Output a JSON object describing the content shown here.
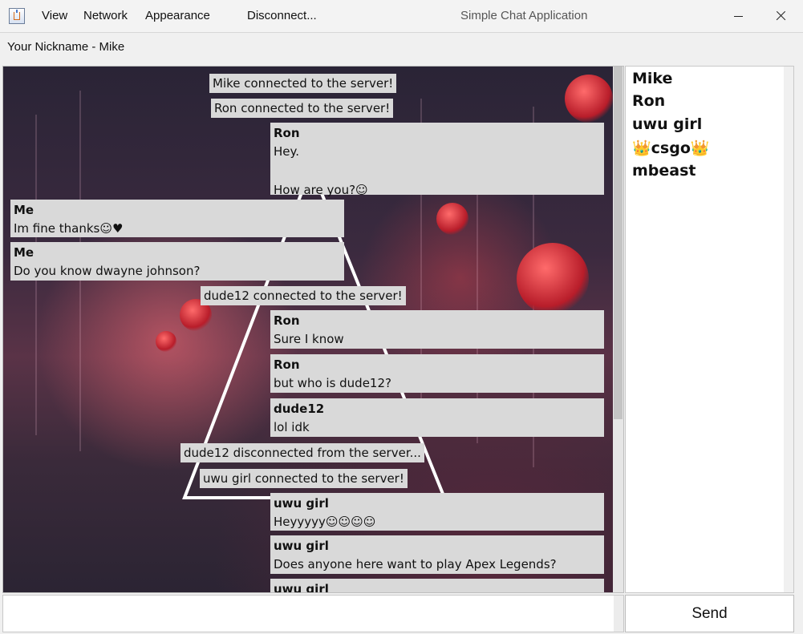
{
  "window": {
    "title": "Simple Chat Application",
    "minimize_glyph": "",
    "close_glyph": ""
  },
  "menu": {
    "items": [
      "View",
      "Network",
      "Appearance",
      "Disconnect..."
    ]
  },
  "nickname_label": "Your Nickname - Mike",
  "messages": {
    "sys1": "Mike connected to the server!",
    "sys2": "Ron connected to the server!",
    "m1": {
      "sender": "Ron",
      "lines": [
        "Hey.",
        "",
        "How are you?☺"
      ]
    },
    "m2": {
      "sender": "Me",
      "lines": [
        "Im fine thanks☺♥"
      ]
    },
    "m3": {
      "sender": "Me",
      "lines": [
        "Do you know dwayne johnson?"
      ]
    },
    "sys3": "dude12 connected to the server!",
    "m4": {
      "sender": "Ron",
      "lines": [
        "Sure I know"
      ]
    },
    "m5": {
      "sender": "Ron",
      "lines": [
        "but who is dude12?"
      ]
    },
    "m6": {
      "sender": "dude12",
      "lines": [
        "lol idk"
      ]
    },
    "sys4": "dude12 disconnected from the server...",
    "sys5": "uwu girl connected to the server!",
    "m7": {
      "sender": "uwu girl",
      "lines": [
        "Heyyyyy☺☺☺☺"
      ]
    },
    "m8": {
      "sender": "uwu girl",
      "lines": [
        "Does anyone here want to play Apex Legends?"
      ]
    },
    "m9": {
      "sender": "uwu girl"
    }
  },
  "users": [
    "Mike",
    "Ron",
    "uwu girl",
    "👑csgo👑",
    "mbeast"
  ],
  "input": {
    "value": "",
    "placeholder": ""
  },
  "send_label": "Send",
  "icons": {
    "app": "java-app-icon",
    "minimize": "minimize-icon",
    "close": "close-icon"
  }
}
